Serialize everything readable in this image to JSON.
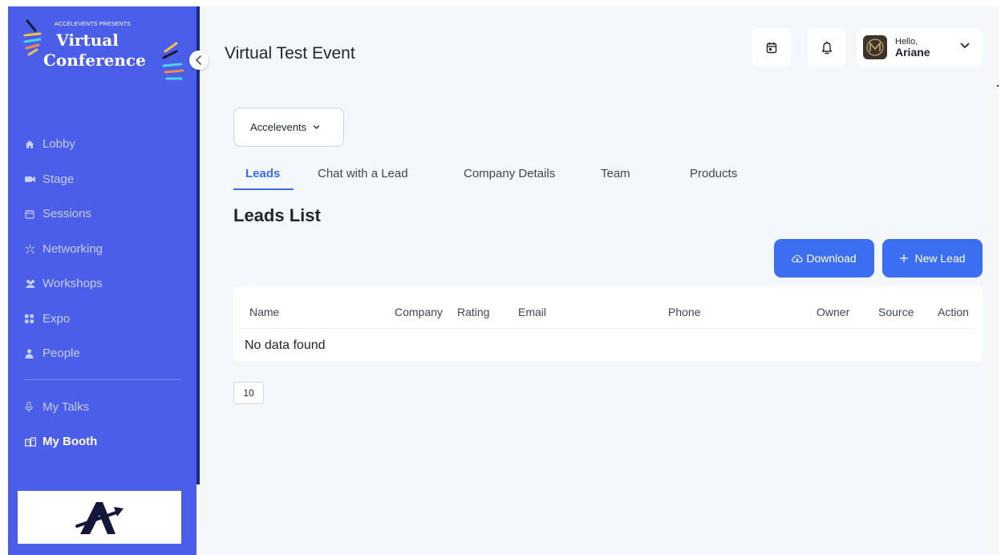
{
  "logo": {
    "presents": "ACCELEVENTS PRESENTS",
    "title_line1": "Virtual",
    "title_line2": "Conference"
  },
  "sidebar": {
    "items": [
      {
        "label": "Lobby",
        "icon": "home-icon"
      },
      {
        "label": "Stage",
        "icon": "camera-icon"
      },
      {
        "label": "Sessions",
        "icon": "calendar-icon"
      },
      {
        "label": "Networking",
        "icon": "network-icon"
      },
      {
        "label": "Workshops",
        "icon": "group-icon"
      },
      {
        "label": "Expo",
        "icon": "grid-icon"
      },
      {
        "label": "People",
        "icon": "person-icon"
      }
    ],
    "secondary_items": [
      {
        "label": "My Talks",
        "icon": "microphone-icon"
      },
      {
        "label": "My Booth",
        "icon": "booth-icon",
        "active": true
      }
    ]
  },
  "header": {
    "event_title": "Virtual Test Event",
    "greeting": "Hello,",
    "user_name": "Ariane"
  },
  "booth_select": {
    "value": "Accelevents"
  },
  "tabs": [
    {
      "label": "Leads",
      "active": true
    },
    {
      "label": "Chat with a Lead"
    },
    {
      "label": "Company Details"
    },
    {
      "label": "Team"
    },
    {
      "label": "Products"
    }
  ],
  "leads": {
    "title": "Leads List",
    "download_label": "Download",
    "new_lead_label": "New Lead",
    "columns": [
      "Name",
      "Company",
      "Rating",
      "Email",
      "Phone",
      "Owner",
      "Source",
      "Action"
    ],
    "empty_text": "No data found",
    "page_size": "10"
  },
  "colors": {
    "sidebar": "#4a5eea",
    "accent": "#3b6ef0",
    "background": "#f4f8fb"
  }
}
